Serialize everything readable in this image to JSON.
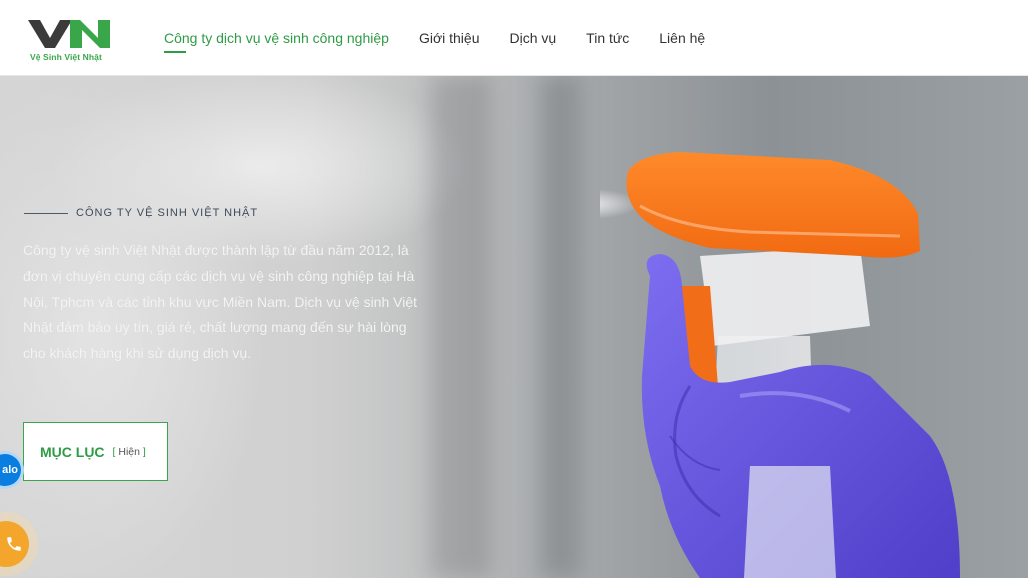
{
  "logo": {
    "mark": "VN",
    "tagline": "Vệ Sinh Việt Nhật",
    "colors": {
      "v": "#3b3b3b",
      "n": "#3aa64a"
    }
  },
  "nav": {
    "items": [
      {
        "label": "Công ty dịch vụ vệ sinh công nghiệp",
        "active": true
      },
      {
        "label": "Giới thiệu"
      },
      {
        "label": "Dịch vụ"
      },
      {
        "label": "Tin tức"
      },
      {
        "label": "Liên hệ"
      }
    ],
    "accent_color": "#2e9b45"
  },
  "hero": {
    "eyebrow": "CÔNG TY VỆ SINH VIỆT NHẬT",
    "description": "Công ty vệ sinh Việt Nhật được thành lập từ đầu năm 2012, là đơn vị chuyên cung cấp các dịch vụ vệ sinh công nghiệp tại Hà Nội, Tphcm và các tỉnh khu vực Miền Nam. Dịch vụ vệ sinh Việt Nhật đảm bảo uy tín, giá rẻ, chất lượng mang đến sự hài lòng cho khách hàng khi sử dụng dịch vụ.",
    "image_icon": "spray-bottle-glove-image"
  },
  "toc": {
    "title": "MỤC LỤC",
    "toggle_open": "[",
    "toggle_label": "Hiện",
    "toggle_close": "]"
  },
  "floating": {
    "zalo_label": "alo",
    "zalo_color": "#0a7ee0",
    "phone_icon": "phone-icon",
    "phone_color": "#f3a62b"
  }
}
